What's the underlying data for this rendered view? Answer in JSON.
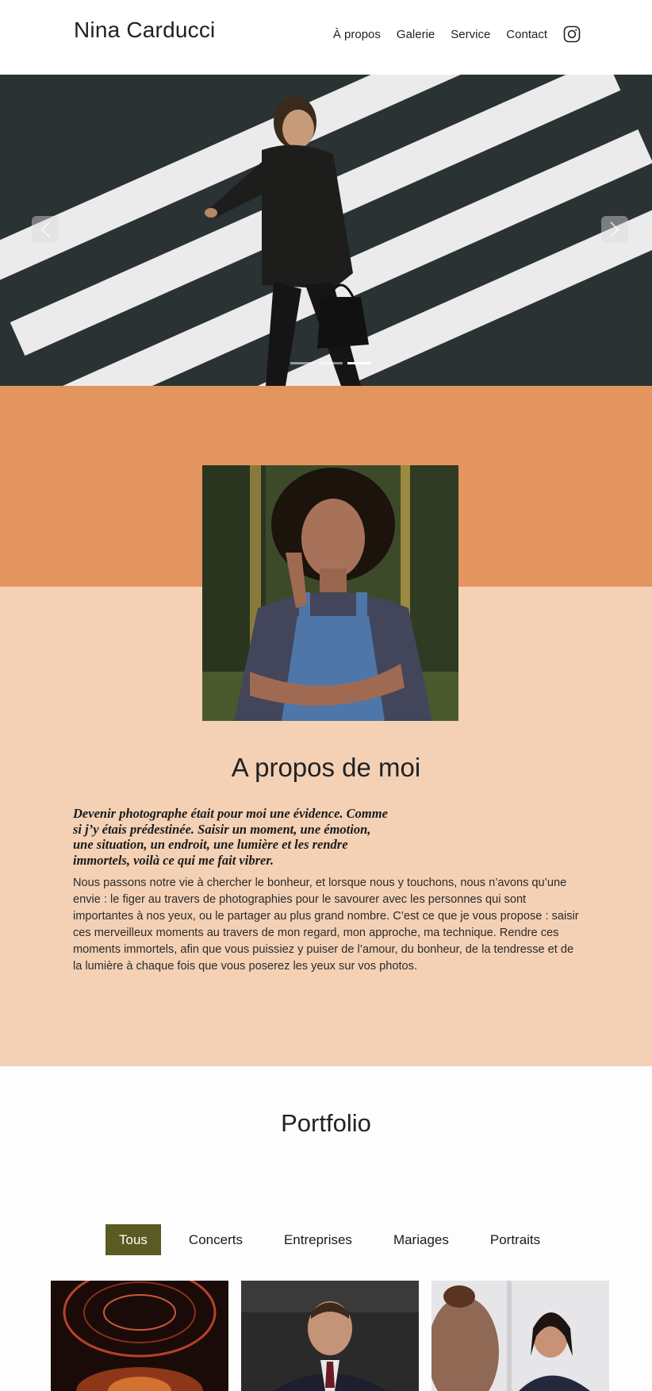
{
  "header": {
    "site_title": "Nina Carducci",
    "nav": [
      {
        "label": "À propos"
      },
      {
        "label": "Galerie"
      },
      {
        "label": "Service"
      },
      {
        "label": "Contact"
      }
    ],
    "instagram_icon": "instagram-icon"
  },
  "carousel": {
    "slide_count": 3,
    "active_slide": 3,
    "prev_icon": "chevron-left-icon",
    "next_icon": "chevron-right-icon"
  },
  "about": {
    "title": "A propos de moi",
    "quote": "Devenir photographe était pour moi une évidence. Comme si j’y étais prédestinée. Saisir un moment, une émotion, une situation, un endroit, une lumière et les rendre immortels, voilà ce qui me fait vibrer.",
    "body": "Nous passons notre vie à chercher le bonheur, et lorsque nous y touchons, nous n’avons qu’une envie : le figer au travers de photographies pour le savourer avec les personnes qui sont importantes à nos yeux, ou le partager au plus grand nombre. C’est ce que je vous propose : saisir ces merveilleux moments au travers de mon regard, mon approche, ma technique. Rendre ces moments immortels, afin que vous puissiez y puiser de l’amour, du bonheur, de la tendresse et de la lumière à chaque fois que vous poserez les yeux sur vos photos."
  },
  "portfolio": {
    "title": "Portfolio",
    "filters": [
      {
        "label": "Tous",
        "active": true
      },
      {
        "label": "Concerts",
        "active": false
      },
      {
        "label": "Entreprises",
        "active": false
      },
      {
        "label": "Mariages",
        "active": false
      },
      {
        "label": "Portraits",
        "active": false
      }
    ]
  },
  "colors": {
    "about_top": "#e4955f",
    "about_bottom": "#f4d1b5",
    "filter_active": "#5a5a23"
  }
}
